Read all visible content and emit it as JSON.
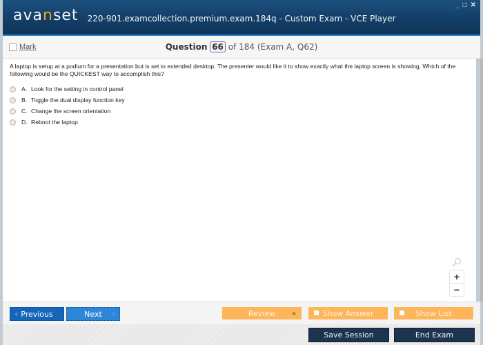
{
  "window": {
    "logo_prefix": "ava",
    "logo_accent": "n",
    "logo_suffix": "set",
    "title": "220-901.examcollection.premium.exam.184q - Custom Exam - VCE Player",
    "controls": {
      "minimize": "_",
      "maximize": "□",
      "close": "✕"
    }
  },
  "subheader": {
    "mark_label": "Mark",
    "question_label": "Question",
    "question_number": "66",
    "question_of": "of 184 (Exam A, Q62)"
  },
  "question": {
    "text": "A laptop is setup at a podium for a presentation but is set to extended desktop. The presenter would like it to show exactly what the laptop screen is showing. Which of the following would be the QUICKEST way to accomplish this?",
    "answers": [
      {
        "letter": "A.",
        "text": "Look for the setting in control panel"
      },
      {
        "letter": "B.",
        "text": "Toggle the dual display function key"
      },
      {
        "letter": "C.",
        "text": "Change the screen orientation"
      },
      {
        "letter": "D.",
        "text": "Reboot the laptop"
      }
    ]
  },
  "zoom": {
    "in": "+",
    "out": "−"
  },
  "nav": {
    "previous": "Previous",
    "next": "Next",
    "review": "Review",
    "show_answer": "Show Answer",
    "show_list": "Show List",
    "save_session": "Save Session",
    "end_exam": "End Exam"
  },
  "colors": {
    "header": "#123d66",
    "accent_orange": "#ffb55a",
    "primary_blue": "#1565b8",
    "dark_button": "#1c3450"
  }
}
